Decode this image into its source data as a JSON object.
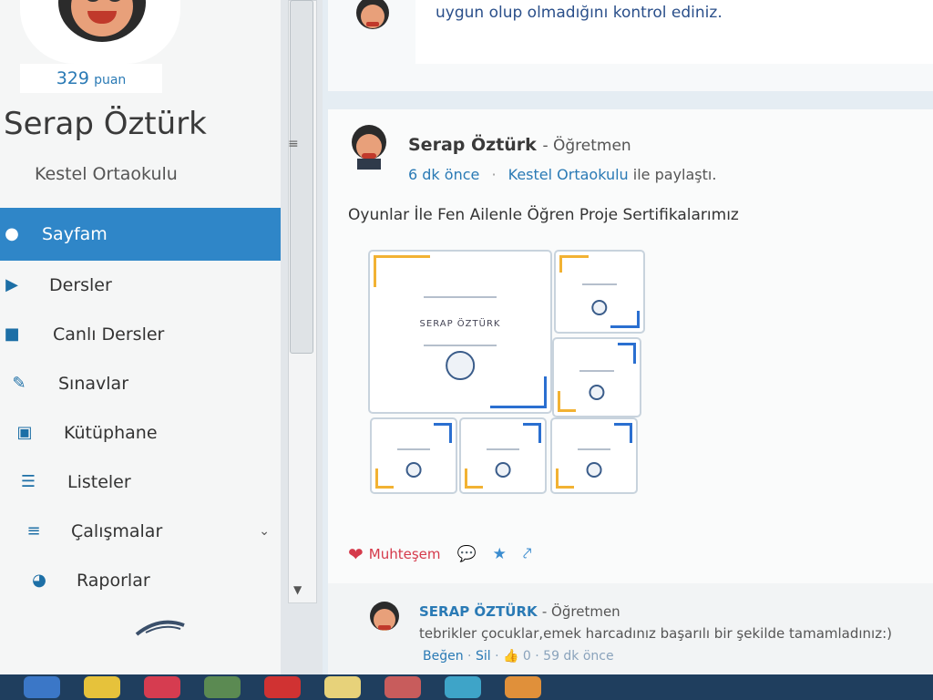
{
  "profile": {
    "points_value": "329",
    "points_unit": "puan",
    "name": "Serap Öztürk",
    "school": "Kestel Ortaokulu"
  },
  "menu": [
    {
      "label": "Sayfam",
      "icon": "user-icon",
      "active": true
    },
    {
      "label": "Dersler",
      "icon": "play-circle-icon"
    },
    {
      "label": "Canlı Dersler",
      "icon": "video-camera-icon"
    },
    {
      "label": "Sınavlar",
      "icon": "pencil-icon"
    },
    {
      "label": "Kütüphane",
      "icon": "library-icon"
    },
    {
      "label": "Listeler",
      "icon": "list-icon"
    },
    {
      "label": "Çalışmalar",
      "icon": "search-list-icon",
      "has_submenu": true
    },
    {
      "label": "Raporlar",
      "icon": "pie-chart-icon"
    }
  ],
  "top_card": {
    "text": "uygun olup olmadığını kontrol ediniz."
  },
  "post": {
    "author": "Serap Öztürk",
    "role": "- Öğretmen",
    "time": "6 dk önce",
    "separator": "·",
    "shared_with": "Kestel Ortaokulu",
    "shared_suffix": "ile paylaştı.",
    "title": "Oyunlar İle Fen Ailenle Öğren Proje Sertifikalarımız",
    "certificate_name": "SERAP ÖZTÜRK",
    "like_label": "Muhteşem"
  },
  "comment": {
    "author": "SERAP ÖZTÜRK",
    "role": "- Öğretmen",
    "text": "tebrikler çocuklar,emek harcadınız başarılı bir şekilde tamamladınız:)",
    "like": "Beğen",
    "delete": "Sil",
    "likes_count": "0",
    "time": "59 dk önce"
  },
  "colors": {
    "accent": "#2f86c8",
    "like": "#d53a4b",
    "taskbar": "#1f3e5e"
  }
}
